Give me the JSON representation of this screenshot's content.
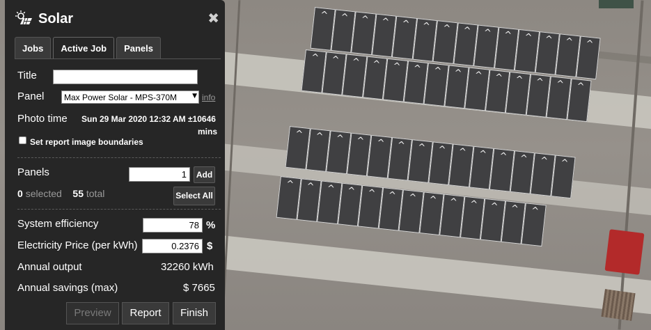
{
  "header": {
    "title": "Solar",
    "close_symbol": "✖"
  },
  "tabs": [
    {
      "label": "Jobs",
      "active": false
    },
    {
      "label": "Active Job",
      "active": true
    },
    {
      "label": "Panels",
      "active": false
    }
  ],
  "job": {
    "title_label": "Title",
    "title_value": "",
    "panel_label": "Panel",
    "panel_value": "Max Power Solar - MPS-370M",
    "panel_info_link": "info",
    "photo_time_label": "Photo time",
    "photo_time_value": "Sun 29 Mar 2020 12:32 AM ±10646",
    "photo_time_unit": "mins",
    "report_boundaries_label": "Set report image boundaries",
    "report_boundaries_checked": false
  },
  "panels": {
    "label": "Panels",
    "count_input": "1",
    "add_label": "Add",
    "selected_count": "0",
    "selected_label": "selected",
    "total_count": "55",
    "total_label": "total",
    "select_all_label": "Select All"
  },
  "results": {
    "efficiency_label": "System efficiency",
    "efficiency_value": "78",
    "efficiency_unit": "%",
    "price_label": "Electricity Price (per kWh)",
    "price_value": "0.2376",
    "price_unit": "$",
    "annual_output_label": "Annual output",
    "annual_output_value": "32260 kWh",
    "annual_savings_label": "Annual savings (max)",
    "annual_savings_value": "$ 7665"
  },
  "actions": {
    "preview_label": "Preview",
    "report_label": "Report",
    "finish_label": "Finish"
  },
  "map": {
    "rows": [
      {
        "panels": 14
      },
      {
        "panels": 14
      },
      {
        "panels": 14
      },
      {
        "panels": 13
      }
    ],
    "panel_symbol": "^"
  },
  "colors": {
    "sidebar_bg": "#262626",
    "panel_fill": "#404042",
    "panel_border": "#d7d7d7",
    "roof": "#8f8a84"
  }
}
